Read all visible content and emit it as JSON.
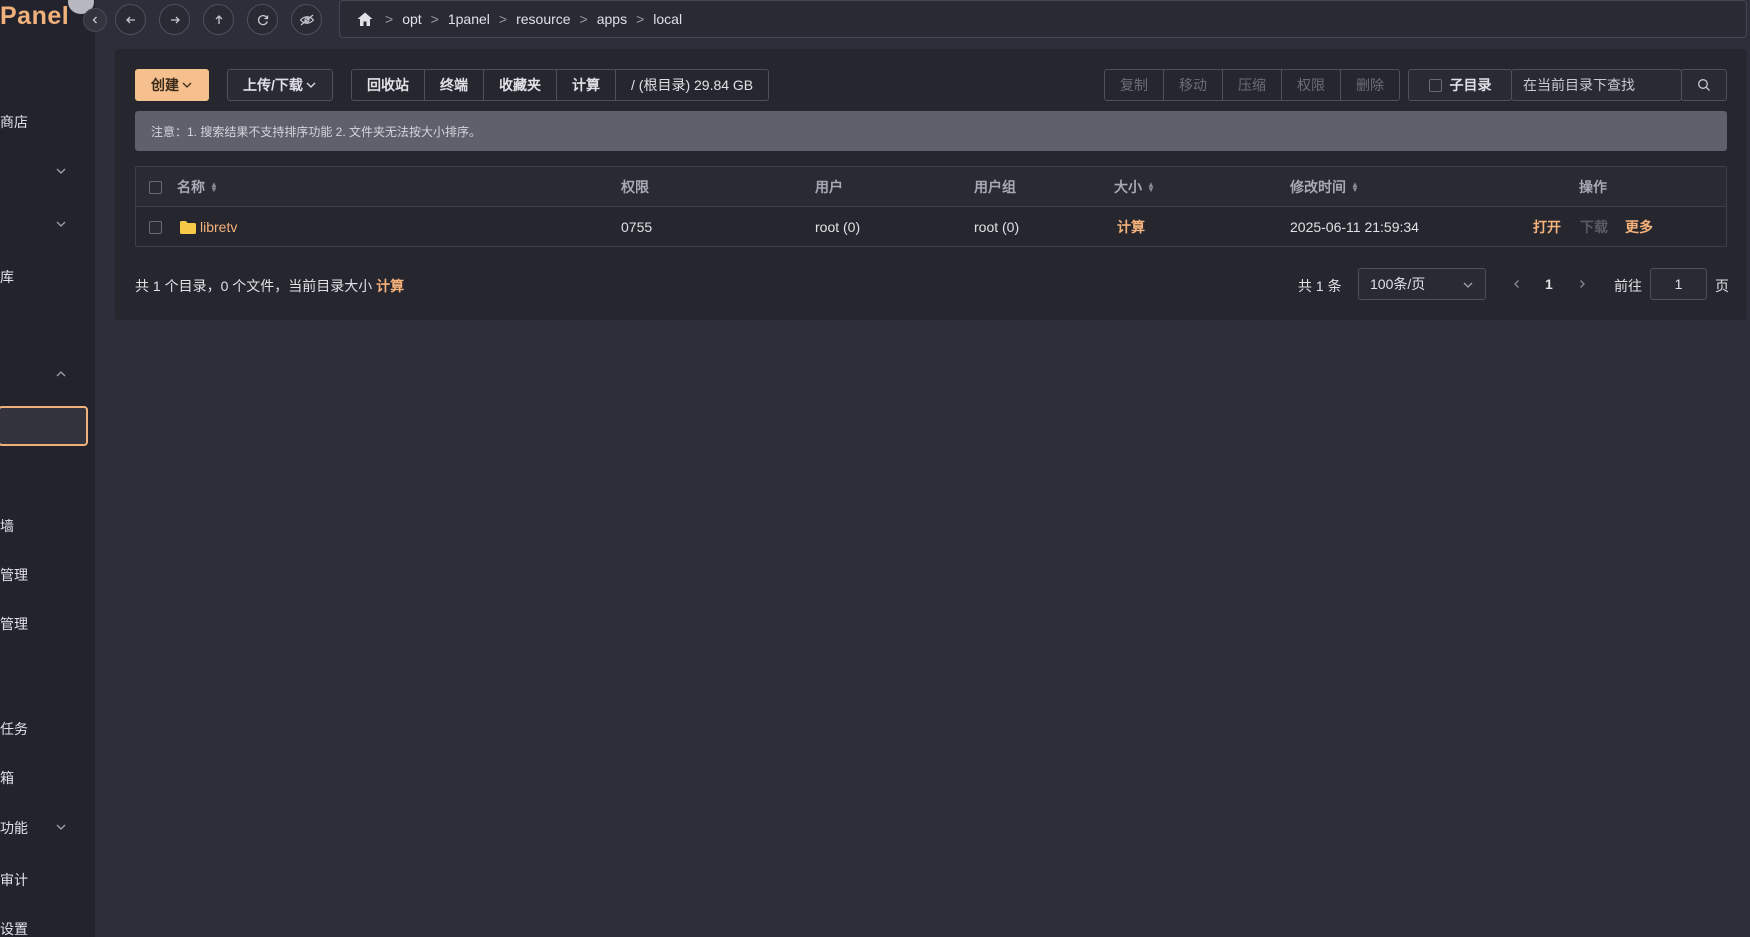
{
  "app": {
    "logo": "Panel"
  },
  "sidebar": {
    "items": [
      {
        "label": "商店"
      },
      {
        "label": "库"
      },
      {
        "label": "墙"
      },
      {
        "label": "管理"
      },
      {
        "label": "管理"
      },
      {
        "label": "任务"
      },
      {
        "label": "箱"
      },
      {
        "label": "功能"
      },
      {
        "label": "审计"
      },
      {
        "label": "设置"
      }
    ]
  },
  "breadcrumb": [
    "opt",
    "1panel",
    "resource",
    "apps",
    "local"
  ],
  "toolbar": {
    "create": "创建",
    "upload_download": "上传/下载",
    "recycle_bin": "回收站",
    "terminal": "终端",
    "favorites": "收藏夹",
    "calculate": "计算",
    "disk_info": "/ (根目录) 29.84 GB",
    "copy": "复制",
    "move": "移动",
    "compress": "压缩",
    "permissions": "权限",
    "delete": "删除",
    "subdir_label": "子目录",
    "search_placeholder": "在当前目录下查找"
  },
  "notice": "注意：1. 搜索结果不支持排序功能 2. 文件夹无法按大小排序。",
  "table": {
    "headers": {
      "name": "名称",
      "permission": "权限",
      "user": "用户",
      "group": "用户组",
      "size": "大小",
      "modified": "修改时间",
      "actions": "操作"
    },
    "rows": [
      {
        "name": "libretv",
        "permission": "0755",
        "user": "root (0)",
        "group": "root (0)",
        "size": "计算",
        "modified": "2025-06-11 21:59:34",
        "open": "打开",
        "download": "下载",
        "more": "更多"
      }
    ]
  },
  "footer": {
    "summary": "共 1 个目录，0 个文件，当前目录大小",
    "calculate": "计算",
    "total": "共 1 条",
    "page_size": "100条/页",
    "current_page": "1",
    "goto_label": "前往",
    "goto_value": "1",
    "page_suffix": "页"
  },
  "colors": {
    "accent": "#f5b27a",
    "background": "#2e2e3a",
    "sidebar": "#23232d",
    "panel": "#26262f",
    "notice": "#5e606c",
    "folder": "#f7c948"
  }
}
